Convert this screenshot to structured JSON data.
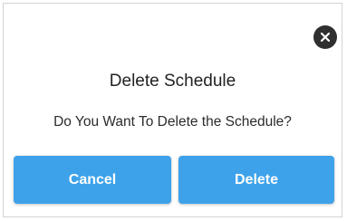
{
  "dialog": {
    "title": "Delete Schedule",
    "message": "Do You Want To Delete the Schedule?",
    "close_icon": "close-icon",
    "cancel_label": "Cancel",
    "delete_label": "Delete"
  },
  "colors": {
    "button_bg": "#3ea2ea",
    "button_text": "#ffffff",
    "close_bg": "#2f2f2f",
    "title_text": "#222222",
    "border": "#d3d3d3"
  }
}
